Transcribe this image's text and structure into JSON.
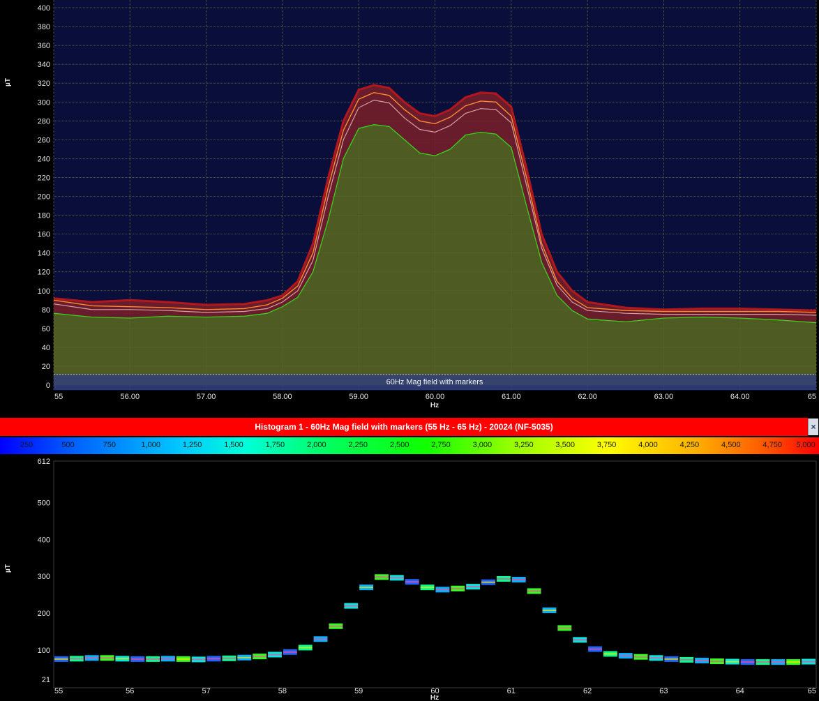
{
  "colors": {
    "plot_bg": "#0a0e3a",
    "grid": "#6b6b3c",
    "max_line": "#d01818",
    "upper_line": "#ff8a30",
    "mid_line": "#d8a0a0",
    "min_line": "#39d11c",
    "band_fill": "#7a1f2a",
    "under_fill": "#5b6a20",
    "marker_band": "#33407a",
    "hist_header": "#ff0000"
  },
  "top_chart": {
    "ylabel": "µT",
    "xlabel": "Hz",
    "band_label": "60Hz Mag field with markers",
    "y_ticks": [
      "0",
      "20",
      "40",
      "60",
      "80",
      "100",
      "120",
      "140",
      "160",
      "180",
      "200",
      "220",
      "240",
      "260",
      "280",
      "300",
      "320",
      "340",
      "360",
      "380",
      "400"
    ],
    "x_ticks": [
      "55",
      "56.00",
      "57.00",
      "58.00",
      "59.00",
      "60.00",
      "61.00",
      "62.00",
      "63.00",
      "64.00",
      "65"
    ]
  },
  "histogram": {
    "header": "Histogram 1 - 60Hz Mag field with markers (55 Hz - 65 Hz) - 20024 (NF-5035)",
    "close_icon": "×",
    "colorbar_labels": [
      "250",
      "500",
      "750",
      "1,000",
      "1,250",
      "1,500",
      "1,750",
      "2,000",
      "2,250",
      "2,500",
      "2,750",
      "3,000",
      "3,250",
      "3,500",
      "3,750",
      "4,000",
      "4,250",
      "4,500",
      "4,750",
      "5,000"
    ],
    "ylabel": "µT",
    "xlabel": "Hz",
    "y_ticks": [
      "21",
      "100",
      "200",
      "300",
      "400",
      "500",
      "612"
    ],
    "x_ticks": [
      "55",
      "56",
      "57",
      "58",
      "59",
      "60",
      "61",
      "62",
      "63",
      "64",
      "65"
    ]
  },
  "chart_data": [
    {
      "type": "area",
      "title": "60Hz Mag field with markers",
      "xlabel": "Hz",
      "ylabel": "µT",
      "xlim": [
        55,
        65
      ],
      "ylim": [
        0,
        400
      ],
      "grid": true,
      "x": [
        55.0,
        55.5,
        56.0,
        56.5,
        57.0,
        57.5,
        57.8,
        58.0,
        58.2,
        58.4,
        58.6,
        58.8,
        59.0,
        59.2,
        59.4,
        59.6,
        59.8,
        60.0,
        60.2,
        60.4,
        60.6,
        60.8,
        61.0,
        61.2,
        61.4,
        61.6,
        61.8,
        62.0,
        62.5,
        63.0,
        63.5,
        64.0,
        64.5,
        65.0
      ],
      "series": [
        {
          "values": [
            92,
            88,
            90,
            88,
            85,
            86,
            90,
            95,
            110,
            150,
            220,
            280,
            313,
            318,
            315,
            300,
            288,
            285,
            292,
            305,
            310,
            309,
            295,
            230,
            160,
            120,
            100,
            88,
            82,
            80,
            81,
            81,
            80,
            79
          ]
        },
        {
          "values": [
            90,
            84,
            83,
            82,
            80,
            81,
            85,
            92,
            105,
            140,
            210,
            270,
            303,
            310,
            307,
            292,
            280,
            277,
            284,
            296,
            301,
            300,
            285,
            220,
            150,
            110,
            92,
            82,
            79,
            78,
            78,
            78,
            78,
            77
          ]
        },
        {
          "values": [
            86,
            80,
            80,
            79,
            77,
            78,
            81,
            88,
            100,
            132,
            200,
            260,
            294,
            302,
            299,
            283,
            271,
            268,
            275,
            288,
            293,
            292,
            278,
            212,
            145,
            106,
            88,
            79,
            76,
            75,
            75,
            75,
            75,
            74
          ]
        },
        {
          "values": [
            76,
            72,
            71,
            73,
            72,
            73,
            76,
            83,
            93,
            120,
            175,
            240,
            272,
            276,
            274,
            260,
            246,
            243,
            250,
            265,
            268,
            266,
            252,
            190,
            130,
            95,
            79,
            70,
            67,
            71,
            72,
            71,
            69,
            66
          ]
        }
      ]
    },
    {
      "type": "heatmap",
      "title": "Histogram 1 - 60Hz Mag field with markers (55 Hz - 65 Hz) - 20024 (NF-5035)",
      "xlabel": "Hz",
      "ylabel": "µT",
      "xlim": [
        55,
        65
      ],
      "ylim": [
        21,
        612
      ],
      "colorbar_range": [
        0,
        5000
      ],
      "x": [
        55.0,
        55.2,
        55.4,
        55.6,
        55.8,
        56.0,
        56.2,
        56.4,
        56.6,
        56.8,
        57.0,
        57.2,
        57.4,
        57.6,
        57.8,
        58.0,
        58.2,
        58.4,
        58.6,
        58.8,
        59.0,
        59.2,
        59.4,
        59.6,
        59.8,
        60.0,
        60.2,
        60.4,
        60.6,
        60.8,
        61.0,
        61.2,
        61.4,
        61.6,
        61.8,
        62.0,
        62.2,
        62.4,
        62.6,
        62.8,
        63.0,
        63.2,
        63.4,
        63.6,
        63.8,
        64.0,
        64.2,
        64.4,
        64.6,
        64.8
      ],
      "values": [
        76,
        77,
        79,
        79,
        77,
        76,
        76,
        77,
        76,
        75,
        77,
        78,
        80,
        83,
        88,
        95,
        107,
        130,
        165,
        220,
        270,
        298,
        296,
        285,
        270,
        264,
        267,
        272,
        284,
        293,
        291,
        260,
        208,
        160,
        128,
        103,
        90,
        85,
        82,
        79,
        76,
        74,
        72,
        70,
        69,
        68,
        68,
        68,
        68,
        69
      ]
    }
  ]
}
